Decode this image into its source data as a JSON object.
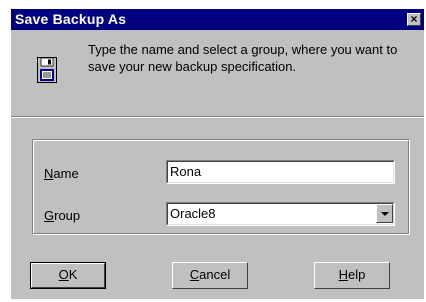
{
  "window": {
    "title": "Save Backup As",
    "close_glyph": "×"
  },
  "header": {
    "icon": "floppy-disk-icon",
    "instruction": "Type the name and select a group, where you want to save your new backup specification."
  },
  "form": {
    "name_label_mnemonic": "N",
    "name_label_rest": "ame",
    "name_value": "Rona",
    "group_label_mnemonic": "G",
    "group_label_rest": "roup",
    "group_value": "Oracle8"
  },
  "buttons": {
    "ok_mnemonic": "O",
    "ok_rest": "K",
    "cancel_mnemonic": "C",
    "cancel_rest": "ancel",
    "help_mnemonic": "H",
    "help_rest": "elp"
  },
  "colors": {
    "titlebar": "#000080",
    "face": "#c0c0c0"
  }
}
